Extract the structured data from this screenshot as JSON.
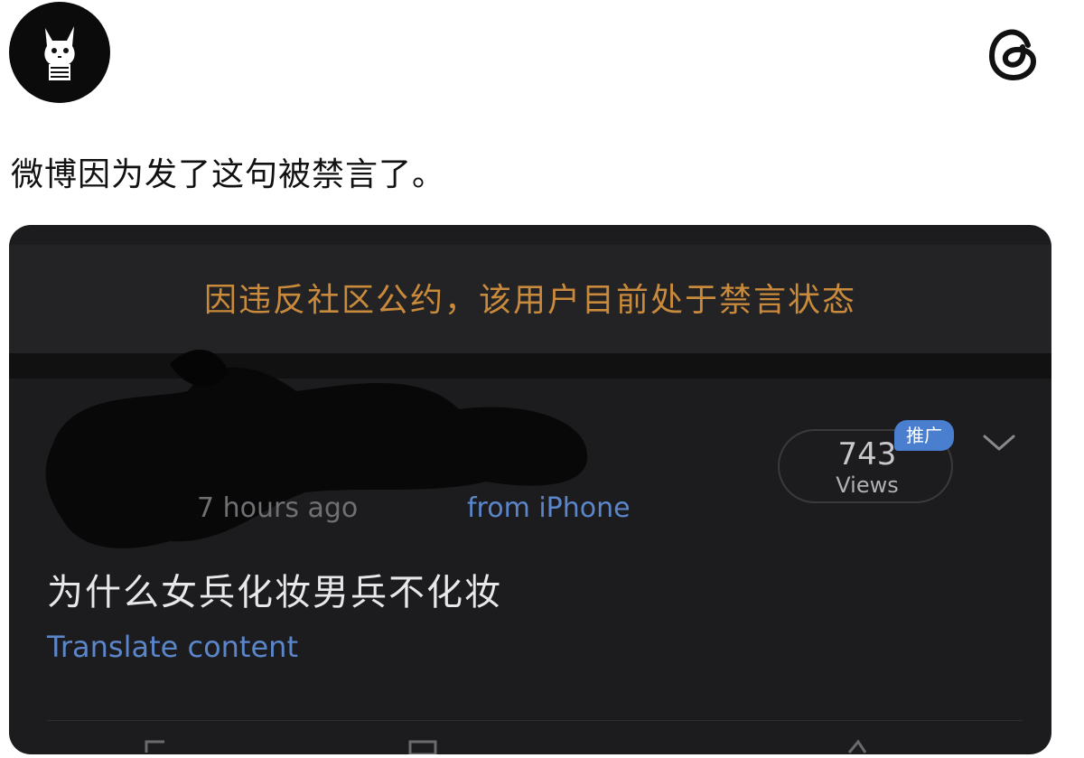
{
  "post": {
    "text": "微博因为发了这句被禁言了。"
  },
  "icons": {
    "avatar": "cartoon-cat-avatar",
    "app": "threads-logo-icon",
    "menu": "chevron-down-icon"
  },
  "embedded_screenshot": {
    "banner": "因违反社区公约，该用户目前处于禁言状态",
    "views": {
      "count": "743",
      "label": "Views",
      "badge": "推广"
    },
    "meta": {
      "time": "7 hours ago",
      "source": "from iPhone"
    },
    "content": "为什么女兵化妆男兵不化妆",
    "translate": "Translate content"
  },
  "colors": {
    "banner_text": "#c98a3c",
    "link_blue": "#5b86c9",
    "badge_blue": "#4a7fd0",
    "card_bg": "#1c1c1e"
  }
}
